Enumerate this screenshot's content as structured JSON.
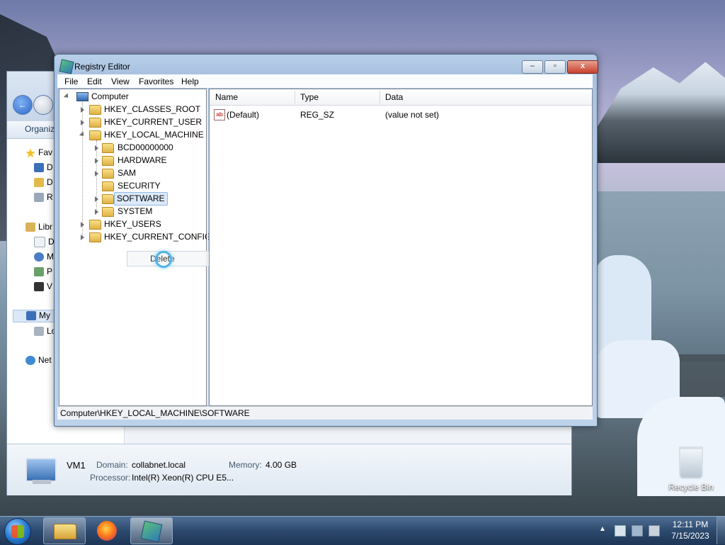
{
  "desktop": {
    "recycle_bin_label": "Recycle Bin"
  },
  "explorer": {
    "toolbar_organize": "Organiz",
    "sidebar": [
      {
        "label": "Fav",
        "icon": "star-icon"
      },
      {
        "label": "D",
        "icon": "desktop-icon"
      },
      {
        "label": "D",
        "icon": "downloads-icon"
      },
      {
        "label": "R",
        "icon": "recent-places-icon"
      },
      {
        "label": "Libr",
        "icon": "libraries-icon"
      },
      {
        "label": "D",
        "icon": "documents-icon"
      },
      {
        "label": "M",
        "icon": "music-icon"
      },
      {
        "label": "P",
        "icon": "pictures-icon"
      },
      {
        "label": "V",
        "icon": "videos-icon"
      },
      {
        "label": "My",
        "icon": "computer-icon"
      },
      {
        "label": "Lo",
        "icon": "local-disk-icon"
      },
      {
        "label": "Net",
        "icon": "network-icon"
      }
    ],
    "details": {
      "computer_name": "VM1",
      "domain_label": "Domain:",
      "domain_value": "collabnet.local",
      "memory_label": "Memory:",
      "memory_value": "4.00 GB",
      "processor_label": "Processor:",
      "processor_value": "Intel(R) Xeon(R) CPU E5..."
    }
  },
  "regedit": {
    "title": "Registry Editor",
    "window_buttons": {
      "minimize": "–",
      "maximize": "▫",
      "close": "x"
    },
    "menu": [
      "File",
      "Edit",
      "View",
      "Favorites",
      "Help"
    ],
    "tree": {
      "root": "Computer",
      "hives": [
        {
          "label": "HKEY_CLASSES_ROOT"
        },
        {
          "label": "HKEY_CURRENT_USER"
        },
        {
          "label": "HKEY_LOCAL_MACHINE"
        },
        {
          "label": "HKEY_USERS"
        },
        {
          "label": "HKEY_CURRENT_CONFIG"
        }
      ],
      "hklm_children": [
        {
          "label": "BCD00000000"
        },
        {
          "label": "HARDWARE"
        },
        {
          "label": "SAM"
        },
        {
          "label": "SECURITY"
        },
        {
          "label": "SOFTWARE",
          "selected": true
        },
        {
          "label": "SYSTEM"
        }
      ]
    },
    "list": {
      "columns": [
        "Name",
        "Type",
        "Data"
      ],
      "rows": [
        {
          "name": "(Default)",
          "type": "REG_SZ",
          "data": "(value not set)",
          "icon": "string-value-icon"
        }
      ]
    },
    "context_menu": {
      "item": "Delete"
    },
    "status_path": "Computer\\HKEY_LOCAL_MACHINE\\SOFTWARE"
  },
  "taskbar": {
    "apps": [
      {
        "name": "Windows Explorer",
        "icon": "folder-icon"
      },
      {
        "name": "Firefox",
        "icon": "firefox-icon"
      },
      {
        "name": "Registry Editor",
        "icon": "regedit-icon",
        "active": true
      }
    ],
    "clock_time": "12:11 PM",
    "clock_date": "7/15/2023"
  }
}
